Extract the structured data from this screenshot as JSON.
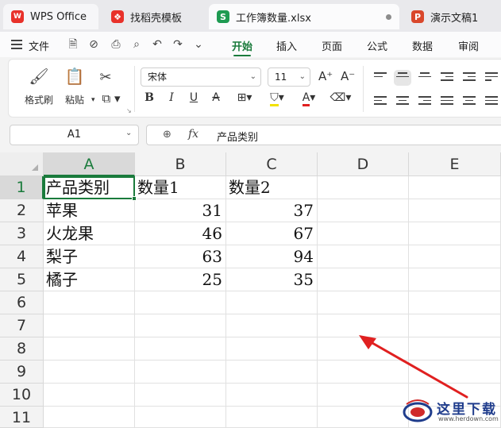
{
  "tabs": [
    {
      "label": "WPS Office",
      "icon": "wps-logo-icon",
      "color": "#e8312a"
    },
    {
      "label": "找稻壳模板",
      "icon": "docer-icon",
      "color": "#e8312a"
    },
    {
      "label": "工作簿数量.xlsx",
      "icon": "spreadsheet-icon",
      "color": "#1f9b52"
    },
    {
      "label": "演示文稿1",
      "icon": "presentation-icon",
      "color": "#d9472b"
    }
  ],
  "tab_icon_letters": {
    "xlsx": "S",
    "ppt": "P"
  },
  "menu": {
    "file_label": "文件",
    "tabs": [
      "开始",
      "插入",
      "页面",
      "公式",
      "数据",
      "审阅"
    ],
    "active_tab": "开始"
  },
  "ribbon": {
    "format_painter": "格式刷",
    "paste": "粘贴",
    "font_name": "宋体",
    "font_size": "11",
    "bold": "B",
    "italic": "I",
    "underline": "U",
    "strike": "A",
    "font_color_accent": "#e02020",
    "highlight_accent": "#f2e200"
  },
  "formula_bar": {
    "cell_ref": "A1",
    "fx": "fx",
    "content": "产品类别"
  },
  "sheet": {
    "columns": [
      "A",
      "B",
      "C",
      "D",
      "E"
    ],
    "rows": [
      "1",
      "2",
      "3",
      "4",
      "5",
      "6",
      "7",
      "8",
      "9",
      "10",
      "11"
    ],
    "cells": [
      [
        "产品类别",
        "数量1",
        "数量2"
      ],
      [
        "苹果",
        "31",
        "37"
      ],
      [
        "火龙果",
        "46",
        "67"
      ],
      [
        "梨子",
        "63",
        "94"
      ],
      [
        "橘子",
        "25",
        "35"
      ]
    ],
    "selected_cell": "A1",
    "selection_color": "#1a7b3c"
  },
  "annotation": {
    "arrow_color": "#e02020"
  },
  "watermark": {
    "text": "这里下载",
    "url": "www.herdown.com"
  }
}
